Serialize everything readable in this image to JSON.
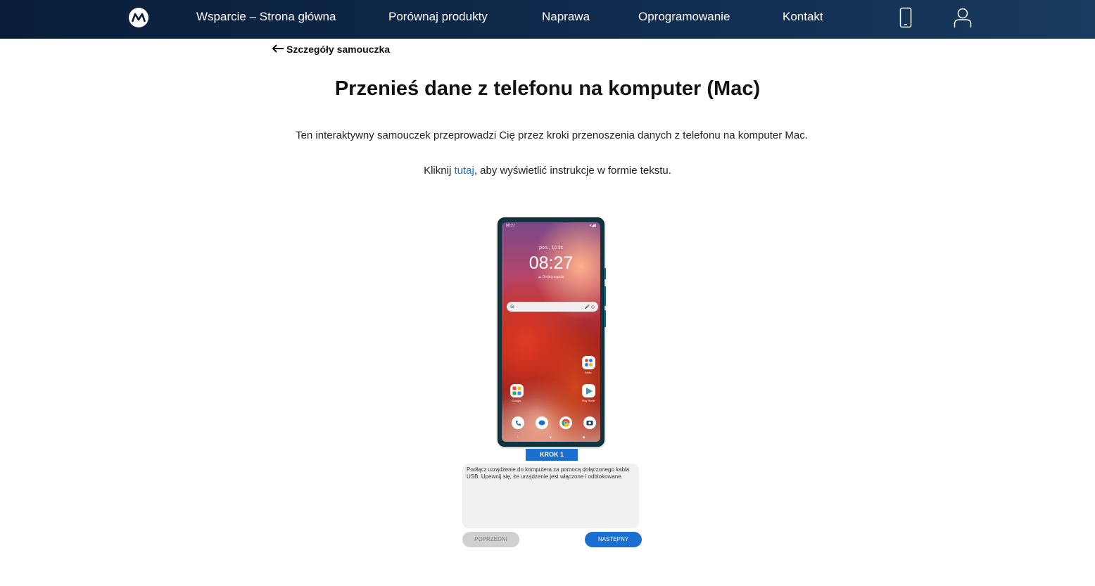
{
  "nav": {
    "logo_icon": "motorola-logo-icon",
    "links": [
      "Wsparcie – Strona główna",
      "Porównaj produkty",
      "Naprawa",
      "Oprogramowanie",
      "Kontakt"
    ],
    "device_icon": "phone-icon",
    "account_icon": "user-icon"
  },
  "back": {
    "label": "Szczegóły samouczka"
  },
  "page": {
    "title": "Przenieś dane z telefonu na komputer (Mac)",
    "intro": "Ten interaktywny samouczek przeprowadzi Cię przez kroki przenoszenia danych z telefonu na komputer Mac.",
    "text_prefix": "Kliknij ",
    "text_link": "tutaj",
    "text_suffix": ", aby wyświetlić instrukcje w formie tekstu."
  },
  "phone": {
    "status_time": "08:27",
    "date": "pon., 10 lis",
    "clock": "08:27",
    "weather": "Dodaj pogodę",
    "apps": [
      "Moto",
      "Google",
      "Play Store"
    ]
  },
  "step": {
    "badge": "KROK 1",
    "text": "Podłącz urządzenie do komputera za pomocą dołączonego kabla USB. Upewnij się, że urządzenie jest włączone i odblokowane.",
    "prev_label": "POPRZEDNI",
    "next_label": "NASTĘPNY"
  },
  "colors": {
    "nav_bg": "#0f2a4d",
    "accent": "#1a6fd1",
    "step_box": "#f2f1ef"
  }
}
